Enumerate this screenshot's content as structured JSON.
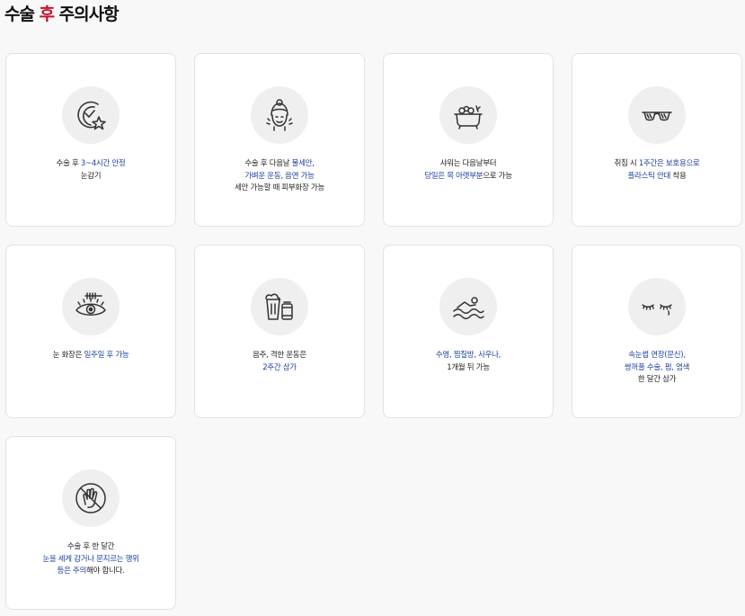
{
  "title": {
    "part1": "수술 ",
    "accent": "후",
    "part2": " 주의사항"
  },
  "colors": {
    "accent": "#c8102e",
    "highlight": "#1b3f9c",
    "card_border": "#e2e2e2",
    "icon_bg": "#efefef"
  },
  "cards": [
    {
      "icon": "clock-star-icon",
      "lines": [
        [
          {
            "t": "수술 후 ",
            "hl": false
          },
          {
            "t": "3~4시간 안정",
            "hl": true
          }
        ],
        [
          {
            "t": "눈감기",
            "hl": false
          }
        ]
      ]
    },
    {
      "icon": "face-wash-icon",
      "lines": [
        [
          {
            "t": "수술 후 다음날 ",
            "hl": false
          },
          {
            "t": "물세안,",
            "hl": true
          }
        ],
        [
          {
            "t": "가벼운 운동, 음연 가능",
            "hl": true
          }
        ],
        [
          {
            "t": "세안 가능할 때 피부화장 가능",
            "hl": false
          }
        ]
      ]
    },
    {
      "icon": "bathtub-icon",
      "lines": [
        [
          {
            "t": "샤워는 다음날부터",
            "hl": false
          }
        ],
        [
          {
            "t": "당일은 목 아랫부분",
            "hl": true
          },
          {
            "t": "으로 가능",
            "hl": false
          }
        ]
      ]
    },
    {
      "icon": "sunglasses-icon",
      "lines": [
        [
          {
            "t": "취침 시 ",
            "hl": false
          },
          {
            "t": "1주간은 보호용으로",
            "hl": true
          }
        ],
        [
          {
            "t": "플라스틱 안대",
            "hl": true
          },
          {
            "t": " 착용",
            "hl": false
          }
        ]
      ]
    },
    {
      "icon": "eye-mascara-icon",
      "lines": [
        [
          {
            "t": "눈 화장은 ",
            "hl": false
          },
          {
            "t": "일주일 후 가능",
            "hl": true
          }
        ]
      ]
    },
    {
      "icon": "beer-can-icon",
      "lines": [
        [
          {
            "t": "음주, 격한 운동은",
            "hl": false
          }
        ],
        [
          {
            "t": "2주간 삼가",
            "hl": true
          }
        ]
      ]
    },
    {
      "icon": "swimming-icon",
      "lines": [
        [
          {
            "t": "수영, 찜질방, 사우나,",
            "hl": true
          }
        ],
        [
          {
            "t": "1개월 뒤 가능",
            "hl": false
          }
        ]
      ]
    },
    {
      "icon": "eyelash-icon",
      "lines": [
        [
          {
            "t": "속눈썹 연장(문신),",
            "hl": true
          }
        ],
        [
          {
            "t": "쌍꺼풀 수술, 펌, 염색",
            "hl": true
          }
        ],
        [
          {
            "t": "한 달간 삼가",
            "hl": false
          }
        ]
      ]
    },
    {
      "icon": "no-hand-icon",
      "lines": [
        [
          {
            "t": "수술 후 한 달간",
            "hl": false
          }
        ],
        [
          {
            "t": "눈을 세게 감거나 문지르는 행위",
            "hl": true
          }
        ],
        [
          {
            "t": "등은 주의",
            "hl": true
          },
          {
            "t": "해야 합니다.",
            "hl": false
          }
        ]
      ]
    }
  ]
}
